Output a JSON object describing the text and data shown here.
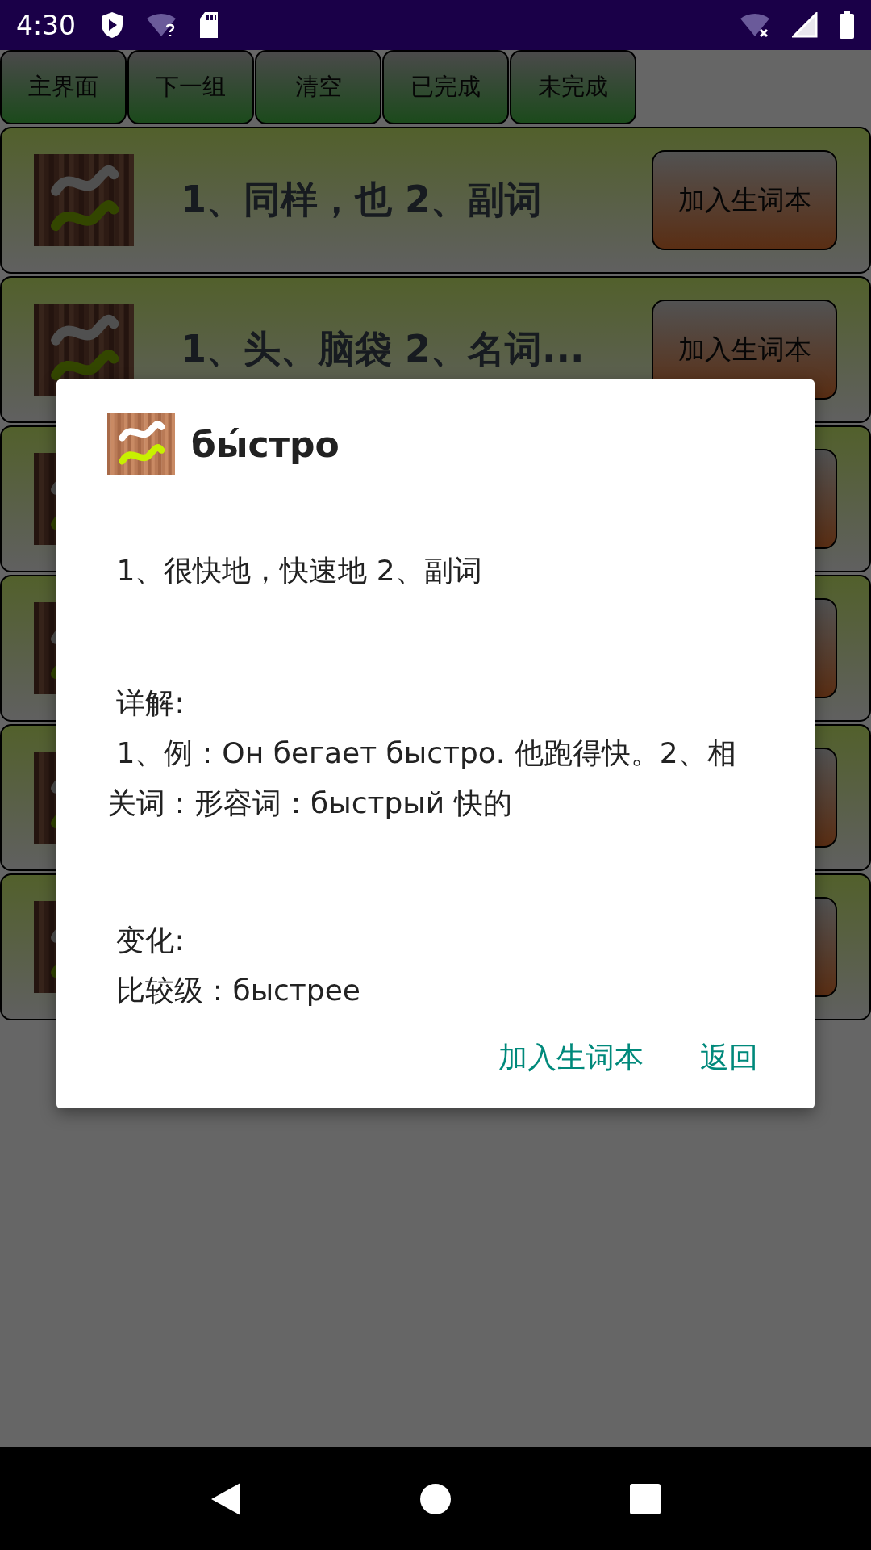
{
  "status_bar": {
    "time": "4:30"
  },
  "toolbar": [
    {
      "label": "主界面"
    },
    {
      "label": "下一组"
    },
    {
      "label": "清空"
    },
    {
      "label": "已完成"
    },
    {
      "label": "未完成"
    }
  ],
  "cards": [
    {
      "kind": "word",
      "meaning": "1、同样，也 2、副词",
      "button": "加入生词本"
    },
    {
      "kind": "word",
      "meaning": "1、头、脑袋 2、名词...",
      "button": "加入生词本"
    },
    {
      "kind": "covered"
    },
    {
      "kind": "covered"
    },
    {
      "kind": "covered"
    },
    {
      "kind": "covered"
    }
  ],
  "dialog": {
    "title": "бы́стро",
    "meaning": " 1、很快地，快速地 2、副词",
    "detail_label": " 详解:",
    "detail_text": " 1、例：Он бегает быстро. 他跑得快。2、相关词：形容词：быстрый 快的",
    "change_label": " 变化:",
    "change_text": " 比较级：быстрее",
    "buttons": [
      "加入生词本",
      "返回"
    ]
  }
}
